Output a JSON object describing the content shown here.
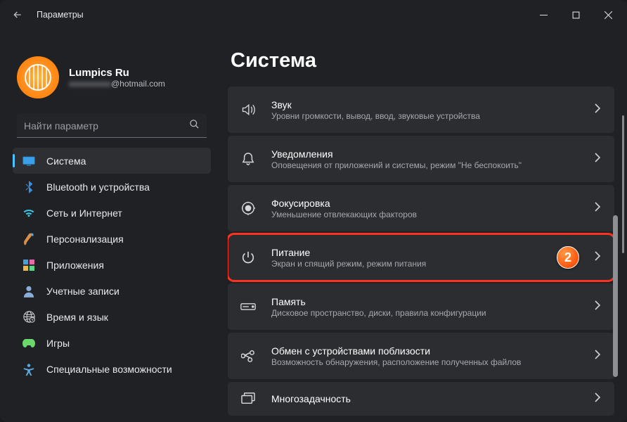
{
  "window": {
    "title": "Параметры"
  },
  "account": {
    "name": "Lumpics Ru",
    "email_blurred": "xxxxxxxxxx",
    "email_clear": "@hotmail.com"
  },
  "search": {
    "placeholder": "Найти параметр"
  },
  "sidebar": {
    "items": [
      {
        "label": "Система",
        "icon": "display",
        "selected": true
      },
      {
        "label": "Bluetooth и устройства",
        "icon": "bluetooth"
      },
      {
        "label": "Сеть и Интернет",
        "icon": "wifi"
      },
      {
        "label": "Персонализация",
        "icon": "brush"
      },
      {
        "label": "Приложения",
        "icon": "apps"
      },
      {
        "label": "Учетные записи",
        "icon": "person"
      },
      {
        "label": "Время и язык",
        "icon": "globe"
      },
      {
        "label": "Игры",
        "icon": "game"
      },
      {
        "label": "Специальные возможности",
        "icon": "access"
      }
    ]
  },
  "page": {
    "heading": "Система"
  },
  "rows": [
    {
      "title": "Звук",
      "subtitle": "Уровни громкости, вывод, ввод, звуковые устройства",
      "icon": "sound"
    },
    {
      "title": "Уведомления",
      "subtitle": "Оповещения от приложений и системы, режим \"Не беспокоить\"",
      "icon": "bell"
    },
    {
      "title": "Фокусировка",
      "subtitle": "Уменьшение отвлекающих факторов",
      "icon": "focus"
    },
    {
      "title": "Питание",
      "subtitle": "Экран и спящий режим, режим питания",
      "icon": "power",
      "highlight": true,
      "badge": "2"
    },
    {
      "title": "Память",
      "subtitle": "Дисковое пространство, диски, правила конфигурации",
      "icon": "storage"
    },
    {
      "title": "Обмен с устройствами поблизости",
      "subtitle": "Возможность обнаружения, расположение полученных файлов",
      "icon": "share"
    },
    {
      "title": "Многозадачность",
      "subtitle": "",
      "icon": "multi"
    }
  ]
}
